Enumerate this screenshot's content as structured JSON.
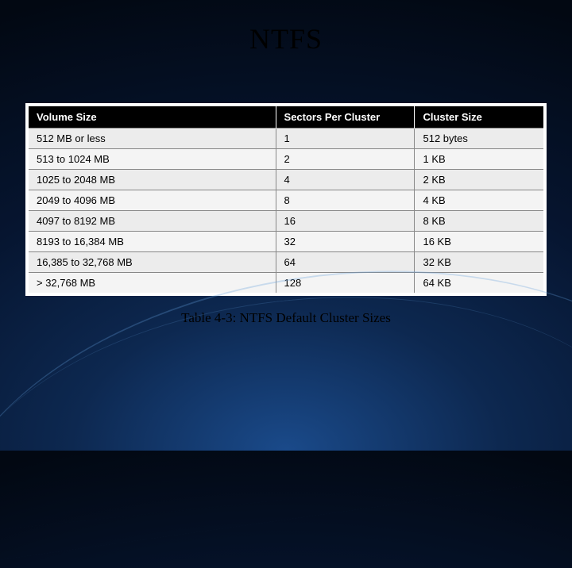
{
  "title": "NTFS",
  "caption": "Table 4-3: NTFS Default Cluster Sizes",
  "headers": {
    "volume": "Volume Size",
    "sectors": "Sectors Per Cluster",
    "cluster": "Cluster Size"
  },
  "chart_data": {
    "type": "table",
    "columns": [
      "Volume Size",
      "Sectors Per Cluster",
      "Cluster Size"
    ],
    "rows": [
      {
        "volume": "512 MB or less",
        "sectors": "1",
        "cluster": "512 bytes"
      },
      {
        "volume": "513 to 1024 MB",
        "sectors": "2",
        "cluster": "1 KB"
      },
      {
        "volume": "1025 to 2048 MB",
        "sectors": "4",
        "cluster": "2 KB"
      },
      {
        "volume": "2049 to 4096 MB",
        "sectors": "8",
        "cluster": "4 KB"
      },
      {
        "volume": "4097 to 8192 MB",
        "sectors": "16",
        "cluster": "8 KB"
      },
      {
        "volume": "8193 to 16,384 MB",
        "sectors": "32",
        "cluster": "16 KB"
      },
      {
        "volume": "16,385 to 32,768 MB",
        "sectors": "64",
        "cluster": "32 KB"
      },
      {
        "volume": "> 32,768 MB",
        "sectors": "128",
        "cluster": "64 KB"
      }
    ]
  }
}
